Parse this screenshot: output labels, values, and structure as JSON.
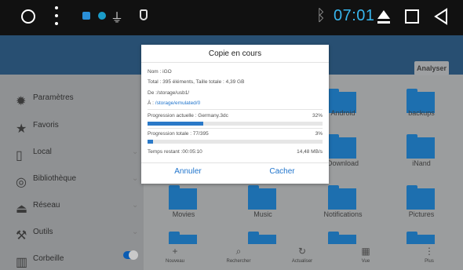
{
  "statusbar": {
    "time": "07:01"
  },
  "app": {
    "analyser_label": "Analyser",
    "sidebar": {
      "items": [
        {
          "label": "Paramètres",
          "icon": "gear-icon"
        },
        {
          "label": "Favoris",
          "icon": "star-icon"
        },
        {
          "label": "Local",
          "icon": "phone-icon"
        },
        {
          "label": "Bibliothèque",
          "icon": "library-icon"
        },
        {
          "label": "Réseau",
          "icon": "network-icon"
        },
        {
          "label": "Outils",
          "icon": "tools-icon"
        },
        {
          "label": "Corbeille",
          "icon": "trash-icon"
        }
      ]
    },
    "grid": {
      "items": [
        "Android",
        "backups",
        "Download",
        "iNand",
        "Movies",
        "Music",
        "Notifications",
        "Pictures"
      ]
    },
    "bottom_bar": {
      "items": [
        {
          "label": "Nouveau",
          "icon": "+"
        },
        {
          "label": "Rechercher",
          "icon": "⌕"
        },
        {
          "label": "Actualiser",
          "icon": "↻"
        },
        {
          "label": "Vue",
          "icon": "▦"
        },
        {
          "label": "Plus",
          "icon": "⋮"
        }
      ]
    }
  },
  "dialog": {
    "title": "Copie en cours",
    "name_line": "Nom : iGO",
    "total_line": "Total : 395 éléments, Taille totale : 4,39 GB",
    "from_label": "De :",
    "from_path": "/storage/usb1/",
    "to_label": "À :",
    "to_path": "/storage/emulated/0",
    "current_progress_label": "Progression actuelle : Germany.3dc",
    "current_progress_pct": "32%",
    "current_progress_value": 32,
    "total_progress_label": "Progression totale : 77/395",
    "total_progress_pct": "3%",
    "total_progress_value": 3,
    "time_remaining": "Temps restant :00:05:10",
    "speed": "14,48 MB/s",
    "cancel_label": "Annuler",
    "hide_label": "Cacher"
  }
}
